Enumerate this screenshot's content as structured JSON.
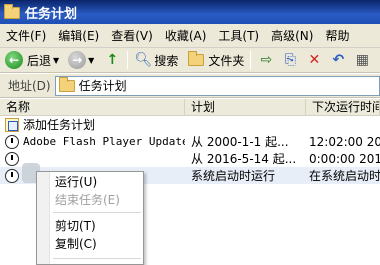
{
  "window": {
    "title": "任务计划"
  },
  "menubar": {
    "items": [
      "文件(F)",
      "编辑(E)",
      "查看(V)",
      "收藏(A)",
      "工具(T)",
      "高级(N)",
      "帮助"
    ]
  },
  "toolbar": {
    "back_label": "后退",
    "search_label": "搜索",
    "folders_label": "文件夹"
  },
  "address": {
    "label": "地址(D)",
    "value": "任务计划"
  },
  "columns": {
    "name": "名称",
    "schedule": "计划",
    "next_run": "下次运行时间"
  },
  "rows": [
    {
      "name": "添加任务计划",
      "schedule": "",
      "next_run": ""
    },
    {
      "name": "Adobe Flash Player Updater",
      "schedule": "从 2000-1-1 起...",
      "next_run": "12:02:00  20"
    },
    {
      "name": "",
      "schedule": "从 2016-5-14 起...",
      "next_run": "0:00:00  201"
    },
    {
      "name": "",
      "schedule": "系统启动时运行",
      "next_run": "在系统启动时"
    }
  ],
  "context_menu": {
    "run": "运行(U)",
    "end_task": "结束任务(E)",
    "cut": "剪切(T)",
    "copy": "复制(C)"
  }
}
